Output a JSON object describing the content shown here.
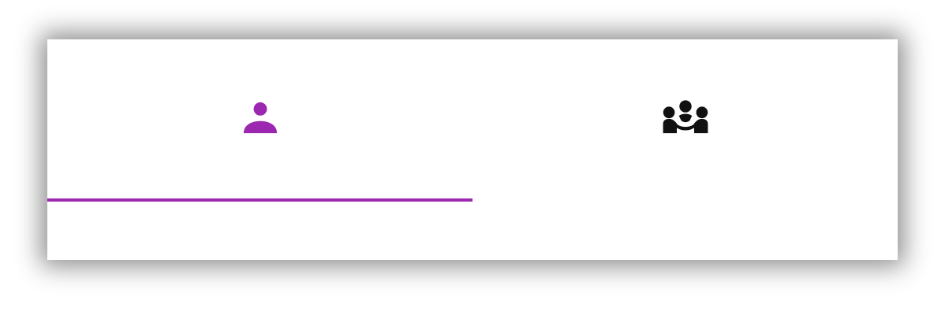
{
  "colors": {
    "accent": "#9c27b0",
    "inactive_icon": "#111111",
    "surface": "#ffffff"
  },
  "tabs": [
    {
      "icon": "person-icon",
      "selected": true
    },
    {
      "icon": "group-icon",
      "selected": false
    }
  ]
}
